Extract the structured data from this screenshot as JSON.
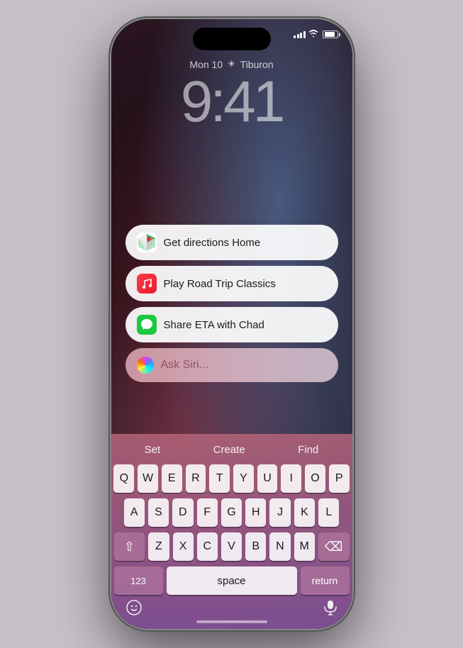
{
  "phone": {
    "status": {
      "time_left": "",
      "signal_label": "signal",
      "wifi_label": "wifi",
      "battery_label": "battery"
    },
    "clock": {
      "date": "Mon 10",
      "weather_icon": "☀",
      "location": "Tiburon",
      "time": "9:41"
    },
    "suggestions": [
      {
        "id": "directions",
        "icon_type": "maps",
        "label": "Get directions Home"
      },
      {
        "id": "music",
        "icon_type": "music",
        "label": "Play Road Trip Classics"
      },
      {
        "id": "messages",
        "icon_type": "messages",
        "label": "Share ETA with Chad"
      }
    ],
    "siri_input": {
      "placeholder": "Ask Siri..."
    },
    "keyboard": {
      "predictive": [
        "Set",
        "Create",
        "Find"
      ],
      "rows": [
        [
          "Q",
          "W",
          "E",
          "R",
          "T",
          "Y",
          "U",
          "I",
          "O",
          "P"
        ],
        [
          "A",
          "S",
          "D",
          "F",
          "G",
          "H",
          "J",
          "K",
          "L"
        ],
        [
          "⇧",
          "Z",
          "X",
          "C",
          "V",
          "B",
          "N",
          "M",
          "⌫"
        ],
        [
          "123",
          "space",
          "return"
        ]
      ]
    }
  }
}
